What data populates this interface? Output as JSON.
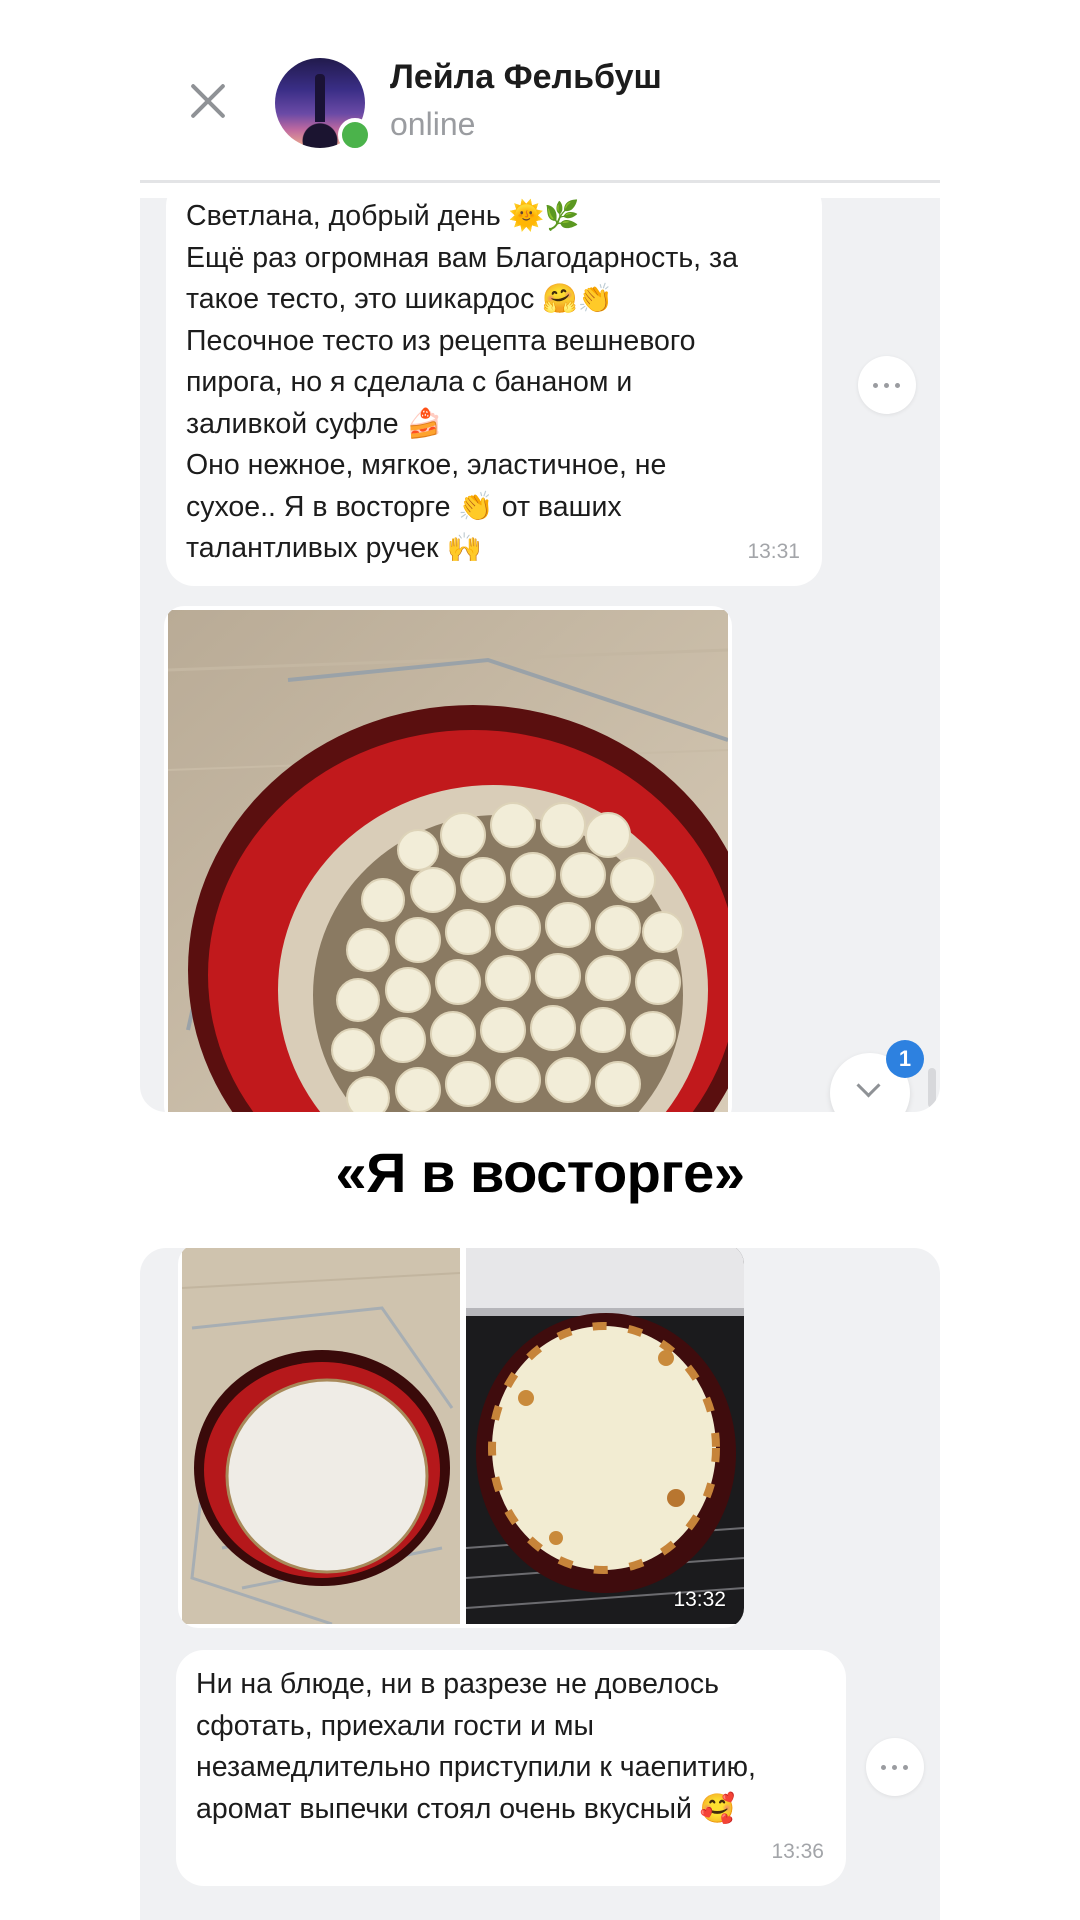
{
  "header": {
    "contact_name": "Лейла Фельбуш",
    "status": "online",
    "close_icon": "close-icon",
    "avatar": "avatar",
    "online_color": "#4bb34b"
  },
  "messages": [
    {
      "lines": [
        "Светлана, добрый день 🌞🌿",
        "Ещё раз огромная вам Благодарность, за",
        "такое тесто, это шикардос 🤗👏",
        "Песочное тесто из рецепта вешневого",
        "пирога, но я сделала с бананом и",
        "заливкой суфле 🍰",
        "Оно нежное, мягкое, эластичное, не",
        "сухое.. Я в восторге 👏 от ваших",
        "талантливых ручек 🙌"
      ],
      "time": "13:31"
    },
    {
      "photo": "banana-tart-photo"
    },
    {
      "photos": [
        "tart-base-photo",
        "baked-tart-photo"
      ],
      "time": "13:32"
    },
    {
      "lines": [
        "Ни на блюде, ни в разрезе не довелось",
        "сфотать, приехали гости и мы",
        "незамедлительно приступили к чаепитию,",
        "аромат выпечки стоял очень вкусный 🥰"
      ],
      "time": "13:36"
    }
  ],
  "scroll_down": {
    "icon": "chevron-down-icon",
    "unread_count": "1",
    "badge_color": "#2d81e0"
  },
  "caption": "«Я в восторге»"
}
